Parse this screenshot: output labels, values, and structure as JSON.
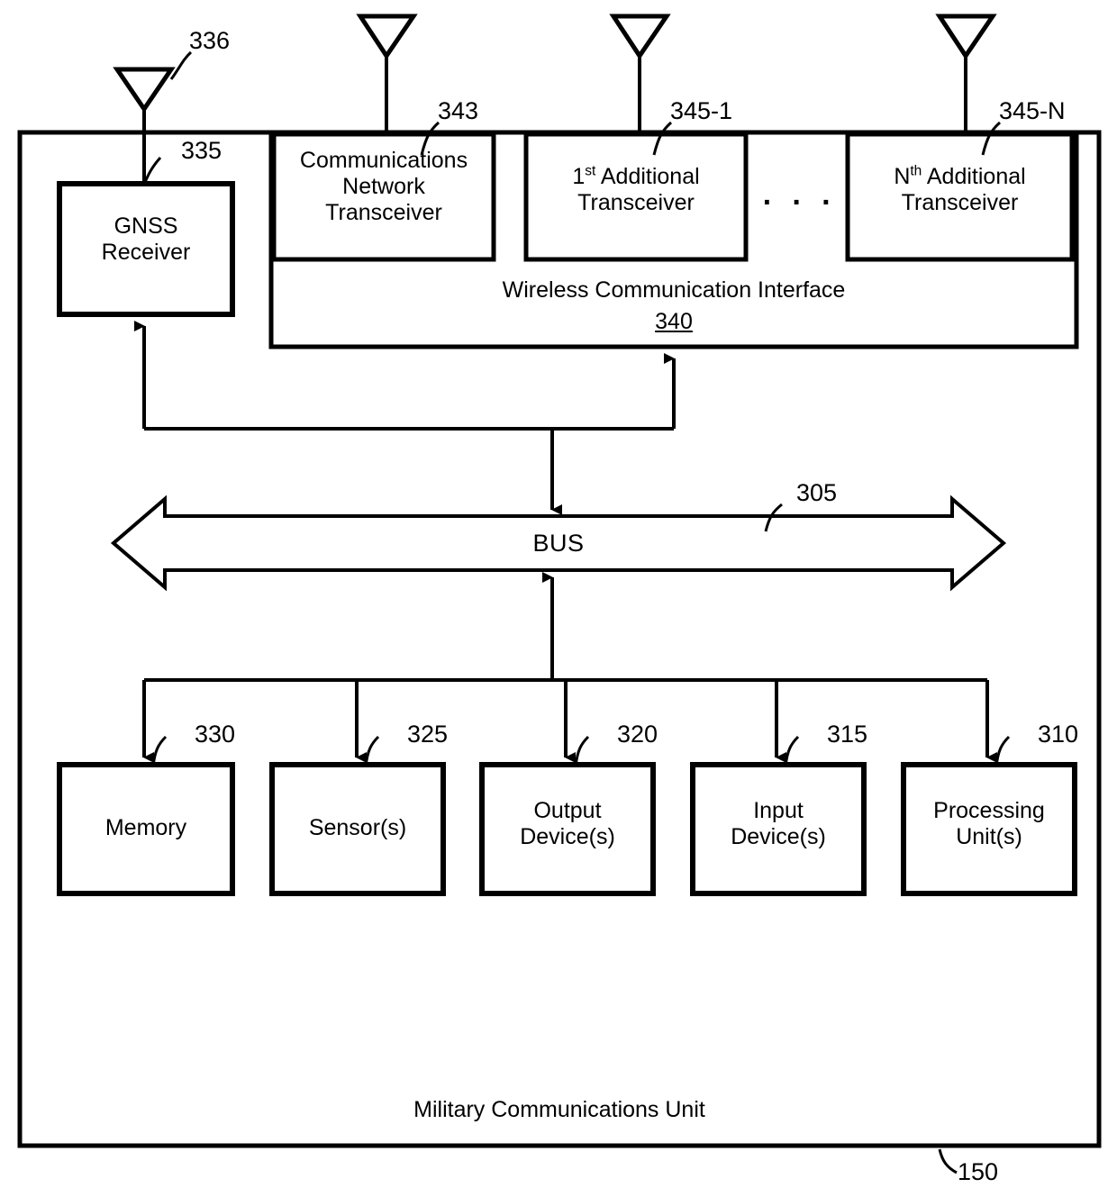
{
  "figure": {
    "title": "Military Communications Unit",
    "outer_ref": "150",
    "bus": {
      "label": "BUS",
      "ref": "305"
    },
    "wireless_interface": {
      "label": "Wireless Communication Interface",
      "ref_number": "340",
      "ellipsis": "· · ·"
    },
    "gnss": {
      "label": "GNSS\nReceiver",
      "ref": "335",
      "antenna_ref": "336"
    },
    "transceivers": [
      {
        "label": "Communications\nNetwork\nTransceiver",
        "ref": "343"
      },
      {
        "label_html": "1<sup>st</sup> Additional\nTransceiver",
        "label": "1st Additional\nTransceiver",
        "ref": "345-1"
      },
      {
        "label_html": "N<sup>th</sup>  Additional\nTransceiver",
        "label": "Nth  Additional\nTransceiver",
        "ref": "345-N"
      }
    ],
    "components": [
      {
        "label": "Memory",
        "ref": "330"
      },
      {
        "label": "Sensor(s)",
        "ref": "325"
      },
      {
        "label": "Output\nDevice(s)",
        "ref": "320"
      },
      {
        "label": "Input\nDevice(s)",
        "ref": "315"
      },
      {
        "label": "Processing\nUnit(s)",
        "ref": "310"
      }
    ],
    "colors": {
      "stroke": "#000000",
      "background": "#ffffff"
    }
  }
}
